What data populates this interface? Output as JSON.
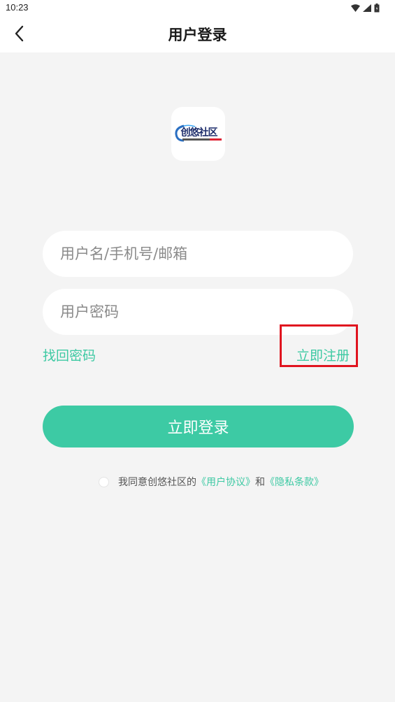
{
  "status_bar": {
    "time": "10:23",
    "icons": [
      "wifi-icon",
      "signal-icon",
      "battery-icon"
    ]
  },
  "header": {
    "title": "用户登录",
    "back_icon": "chevron-left-icon"
  },
  "logo": {
    "text": "创悠社区"
  },
  "form": {
    "username_placeholder": "用户名/手机号/邮箱",
    "password_placeholder": "用户密码",
    "forgot_label": "找回密码",
    "register_label": "立即注册",
    "login_label": "立即登录"
  },
  "agreement": {
    "prefix": "我同意创悠社区的",
    "user_agreement": "《用户协议》",
    "connector": "和",
    "privacy": "《隐私条款》"
  },
  "colors": {
    "accent": "#3dcaa4",
    "highlight": "#e0141f",
    "background": "#f4f4f4"
  }
}
